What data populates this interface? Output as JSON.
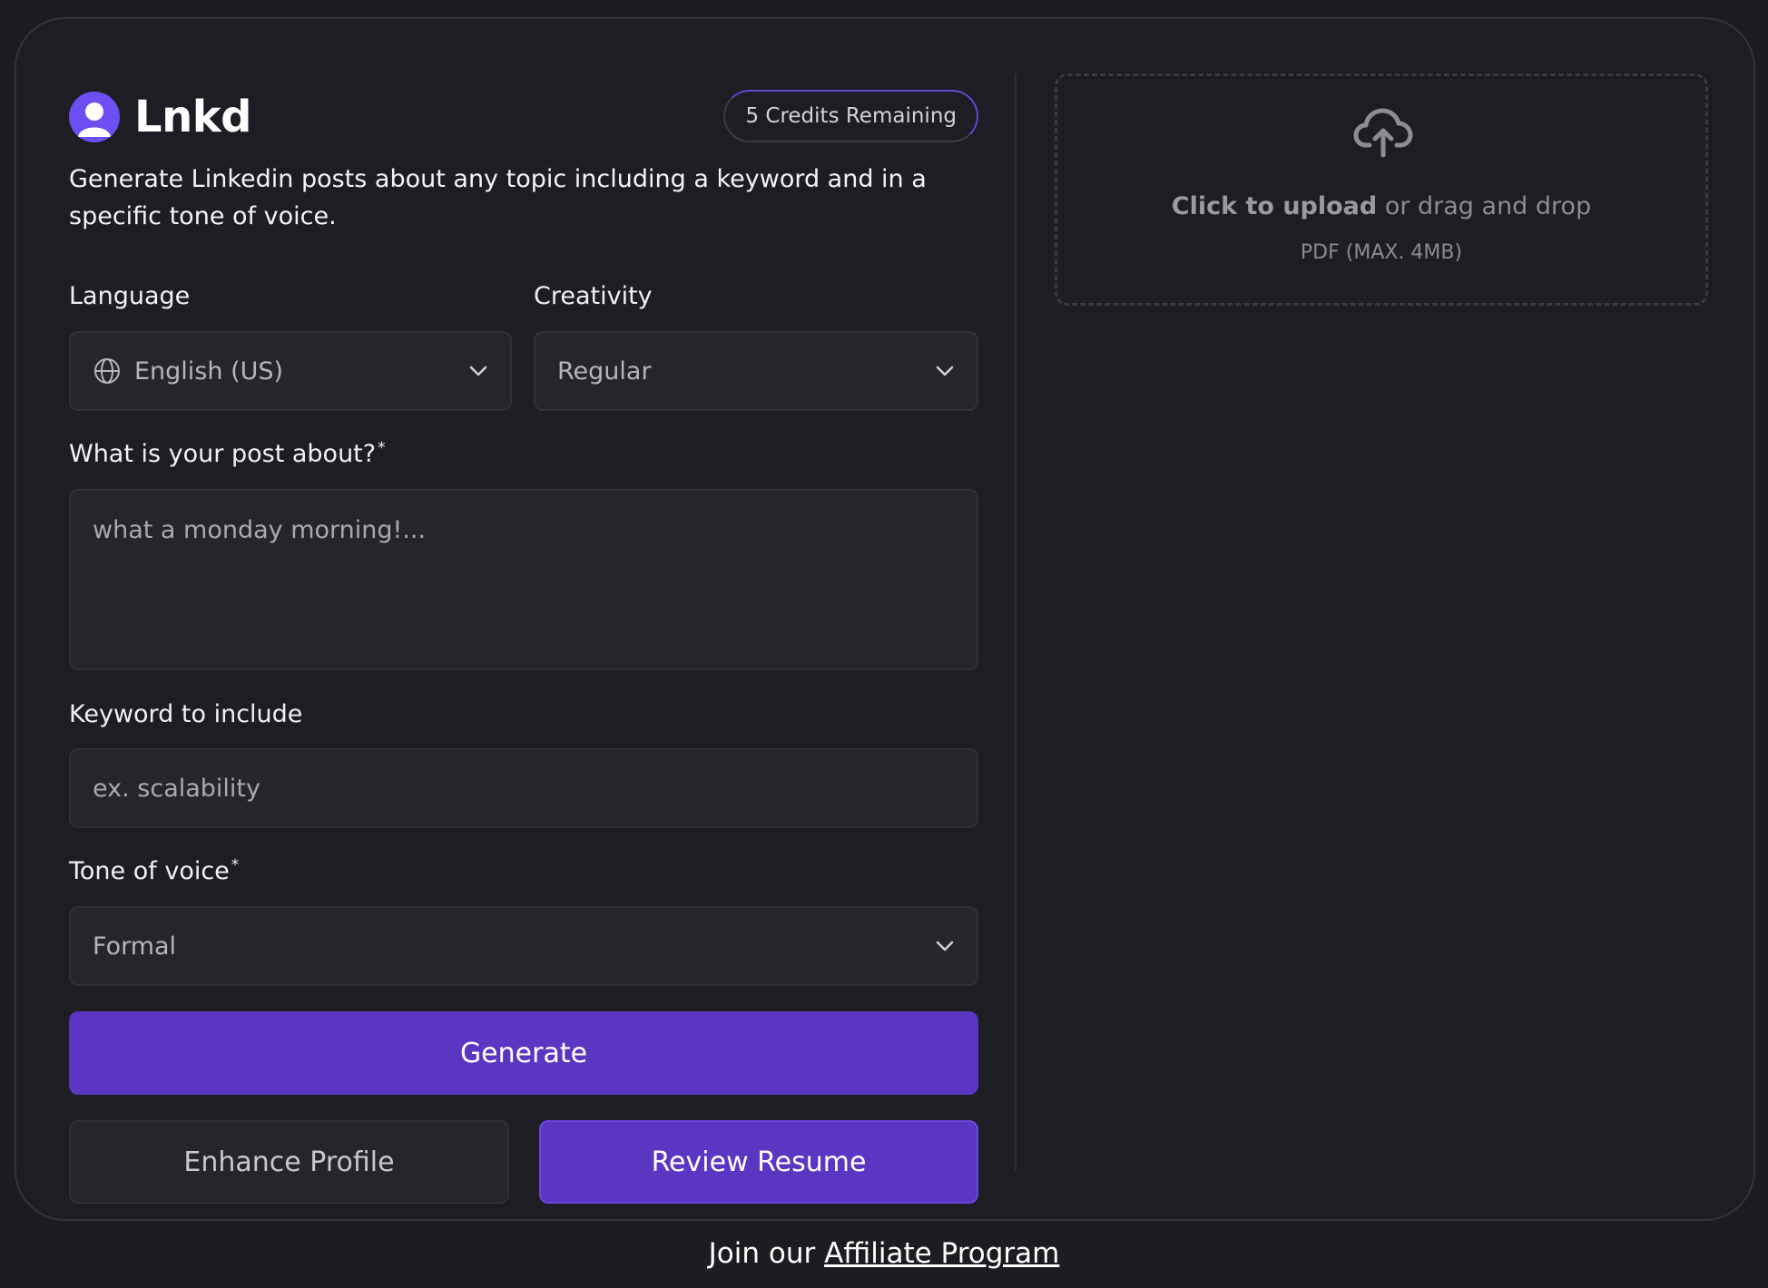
{
  "brand": {
    "name": "Lnkd"
  },
  "credits": {
    "label": "5 Credits Remaining"
  },
  "description": "Generate Linkedin posts about any topic including a keyword and in a specific tone of voice.",
  "language": {
    "label": "Language",
    "value": "English (US)"
  },
  "creativity": {
    "label": "Creativity",
    "value": "Regular"
  },
  "post": {
    "label": "What is your post about?",
    "required_mark": "*",
    "placeholder": "what a monday morning!..."
  },
  "keyword": {
    "label": "Keyword to include",
    "placeholder": "ex. scalability"
  },
  "tone": {
    "label": "Tone of voice",
    "required_mark": "*",
    "value": "Formal"
  },
  "buttons": {
    "generate": "Generate",
    "enhance": "Enhance Profile",
    "review": "Review Resume"
  },
  "upload": {
    "click_text": "Click to upload",
    "rest_text": " or drag and drop",
    "hint": "PDF (MAX. 4MB)"
  },
  "footer": {
    "prefix": "Join our ",
    "link": "Affiliate Program"
  },
  "colors": {
    "accent": "#5b36c2",
    "avatar": "#6d4ef2",
    "background": "#1c1c21",
    "field": "#25252b"
  }
}
